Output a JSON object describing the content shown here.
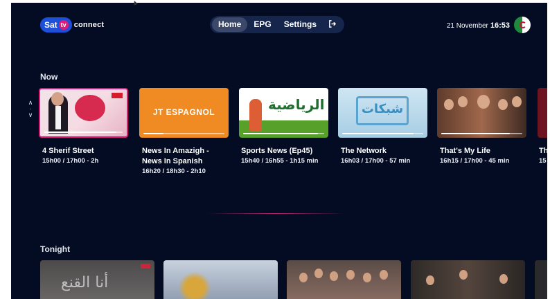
{
  "header": {
    "logo": {
      "brand": "Sat",
      "tv": "tv",
      "suffix": "connect"
    },
    "nav": [
      {
        "label": "Home",
        "active": true
      },
      {
        "label": "EPG",
        "active": false
      },
      {
        "label": "Settings",
        "active": false
      }
    ],
    "logout_icon": "logout-icon",
    "date": "21 November",
    "time": "16:53",
    "avatar_icon": "algeria-flag-icon"
  },
  "now": {
    "title": "Now",
    "cards": [
      {
        "title": "4 Sherif Street",
        "title2": "",
        "time": "15h00 / 17h00 - 2h",
        "progress": 0.92,
        "focused": true
      },
      {
        "title": "News In Amazigh -",
        "title2": "News In Spanish",
        "time": "16h20 / 18h30 - 2h10",
        "progress": 0.25,
        "art_text": "JT ESPAGNOL"
      },
      {
        "title": "Sports News (Ep45)",
        "title2": "",
        "time": "15h40 / 16h55 - 1h15 min",
        "progress": 0.92,
        "art_text": "الرياضية"
      },
      {
        "title": "The Network",
        "title2": "",
        "time": "16h03 / 17h00 - 57 min",
        "progress": 0.88,
        "art_text": "شبكات"
      },
      {
        "title": "That's My Life",
        "title2": "",
        "time": "16h15 / 17h00 - 45 min",
        "progress": 0.85
      },
      {
        "title": "Th",
        "title2": "",
        "time": "15",
        "progress": 0.5
      }
    ]
  },
  "tonight": {
    "title": "Tonight",
    "cards": [
      {
        "art_text": "أنا القنع"
      },
      {
        "art_text": ""
      },
      {
        "art_text": ""
      },
      {
        "art_text": ""
      },
      {
        "art_text": ""
      }
    ]
  },
  "colors": {
    "background": "#040c24",
    "accent": "#e0197c",
    "nav_bg": "#16254c",
    "logo_blue": "#1d4fd8"
  }
}
